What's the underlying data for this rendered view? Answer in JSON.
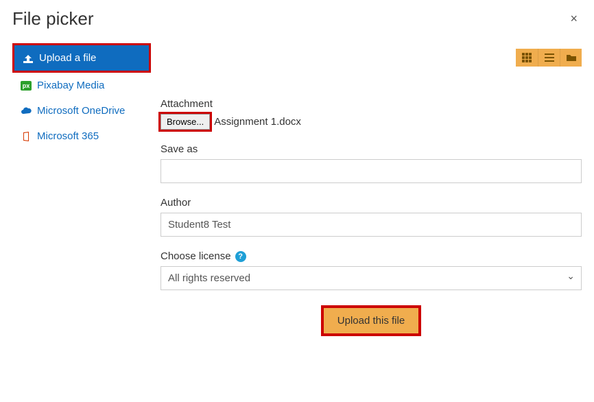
{
  "header": {
    "title": "File picker",
    "close_glyph": "×"
  },
  "sidebar": {
    "items": [
      {
        "label": "Upload a file",
        "icon": "upload-icon",
        "active": true
      },
      {
        "label": "Pixabay Media",
        "icon": "pixabay-icon",
        "active": false
      },
      {
        "label": "Microsoft OneDrive",
        "icon": "onedrive-icon",
        "active": false
      },
      {
        "label": "Microsoft 365",
        "icon": "m365-icon",
        "active": false
      }
    ]
  },
  "view_toolbar": {
    "grid": "grid-view-icon",
    "list": "list-view-icon",
    "tree": "folder-view-icon"
  },
  "form": {
    "attachment_label": "Attachment",
    "browse_button": "Browse...",
    "selected_file": "Assignment 1.docx",
    "save_as_label": "Save as",
    "save_as_value": "",
    "author_label": "Author",
    "author_value": "Student8 Test",
    "license_label": "Choose license",
    "license_value": "All rights reserved",
    "submit_button": "Upload this file"
  }
}
